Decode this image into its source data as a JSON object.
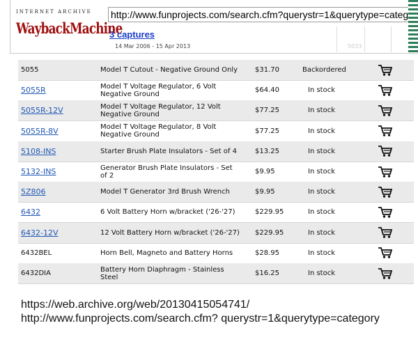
{
  "wayback": {
    "logo_top": "INTERNET ARCHIVE",
    "logo_main": "WaybackMachine",
    "url": "http://www.funprojects.com/search.cfm?querystr=1&querytype=category",
    "captures": "3 captures",
    "date_range": "14 Mar 2006 - 15 Apr 2013",
    "ghost_label": "5033",
    "accent_color": "#a01010",
    "link_color": "#1a3cc9"
  },
  "products": [
    {
      "sku": "5055",
      "link": false,
      "desc": "Model T Cutout - Negative Ground Only",
      "price": "$31.70",
      "availability": "Backordered"
    },
    {
      "sku": "5055R",
      "link": true,
      "desc": "Model T Voltage Regulator, 6 Volt Negative Ground",
      "price": "$64.40",
      "availability": "In stock"
    },
    {
      "sku": "5055R-12V",
      "link": true,
      "desc": "Model T Voltage Regulator, 12 Volt Negative Ground",
      "price": "$77.25",
      "availability": "In stock"
    },
    {
      "sku": "5055R-8V",
      "link": true,
      "desc": "Model T Voltage Regulator, 8 Volt Negative Ground",
      "price": "$77.25",
      "availability": "In stock"
    },
    {
      "sku": "5108-INS",
      "link": true,
      "desc": "Starter Brush Plate Insulators - Set of 4",
      "price": "$13.25",
      "availability": "In stock"
    },
    {
      "sku": "5132-INS",
      "link": true,
      "desc": "Generator Brush Plate Insulators - Set of 2",
      "price": "$9.95",
      "availability": "In stock"
    },
    {
      "sku": "5Z806",
      "link": true,
      "desc": "Model T Generator 3rd Brush Wrench",
      "price": "$9.95",
      "availability": "In stock"
    },
    {
      "sku": "6432",
      "link": true,
      "desc": "6 Volt Battery Horn w/bracket ('26-'27)",
      "price": "$229.95",
      "availability": "In stock"
    },
    {
      "sku": "6432-12V",
      "link": true,
      "desc": "12 Volt Battery Horn w/bracket ('26-'27)",
      "price": "$229.95",
      "availability": "In stock"
    },
    {
      "sku": "6432BEL",
      "link": false,
      "desc": "Horn Bell, Magneto and Battery Horns",
      "price": "$28.95",
      "availability": "In stock"
    },
    {
      "sku": "6432DIA",
      "link": false,
      "desc": "Battery Horn Diaphragm - Stainless Steel",
      "price": "$16.25",
      "availability": "In stock"
    }
  ],
  "cart_icon": "shopping-cart-icon",
  "caption": "https://web.archive.org/web/20130415054741/ http://www.funprojects.com/search.cfm? querystr=1&querytype=category"
}
